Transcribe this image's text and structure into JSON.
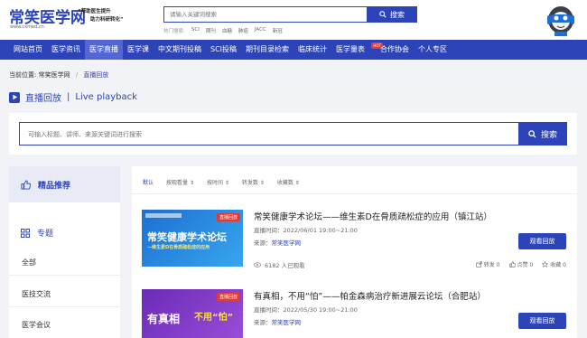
{
  "header": {
    "logo": "常笑医学网",
    "logo_url": "www.cxmed.cn",
    "slogan_line1": "“帮助医生提升",
    "slogan_line2": "助力科研转化”",
    "search_placeholder": "请输入关键词搜索",
    "search_button": "搜索",
    "hot_label": "热门搜索:",
    "hot_terms": [
      "SCI",
      "期刊",
      "血糖",
      "肺癌",
      "JACC",
      "新冠"
    ]
  },
  "nav": {
    "items": [
      "网站首页",
      "医学资讯",
      "医学直播",
      "医学课",
      "中文期刊投稿",
      "SCI投稿",
      "期刊目录检索",
      "临床统计",
      "医学量表",
      "合作协会",
      "个人专区"
    ],
    "active_index": 2,
    "hot_badge": "HOT"
  },
  "breadcrumb": {
    "label": "当前位置:",
    "home": "常笑医学网",
    "current": "直播回放"
  },
  "section": {
    "title": "直播回放",
    "subtitle": "Live playback"
  },
  "main_search": {
    "placeholder": "可输入标题、讲师、来源关键词进行搜索",
    "button": "搜索"
  },
  "sidebar": {
    "recommend": "精品推荐",
    "topic": "专题",
    "items": [
      "全部",
      "医技交流",
      "医学会议"
    ]
  },
  "sort": {
    "items": [
      "默认",
      "按观看量",
      "按时间",
      "转发数",
      "收藏数"
    ],
    "active_index": 0
  },
  "lives": [
    {
      "title": "常笑健康学术论坛——维生素D在骨质疏松症的应用（镇江站）",
      "time_label": "直播时间：",
      "time": "2022/06/01 19:00~21:00",
      "source_label": "来源：",
      "source": "常笑医学网",
      "button": "观看回放",
      "views": "6182 人已观看",
      "shares": "转发 0",
      "likes": "点赞 0",
      "favorites": "收藏 0",
      "thumb_badge": "直播回放",
      "thumb_text1": "常笑健康学术论坛",
      "thumb_text2": "—维生素D在骨质疏松症的应用"
    },
    {
      "title": "有真相，不用“怕”——帕金森病治疗新进展云论坛（合肥站）",
      "time_label": "直播时间：",
      "time": "2022/05/30 19:00~21:00",
      "source_label": "来源：",
      "source": "常笑医学网",
      "button": "观看回放",
      "thumb_badge": "直播回放",
      "thumb_text1": "有真相",
      "thumb_text2": "不用“怕”"
    }
  ]
}
